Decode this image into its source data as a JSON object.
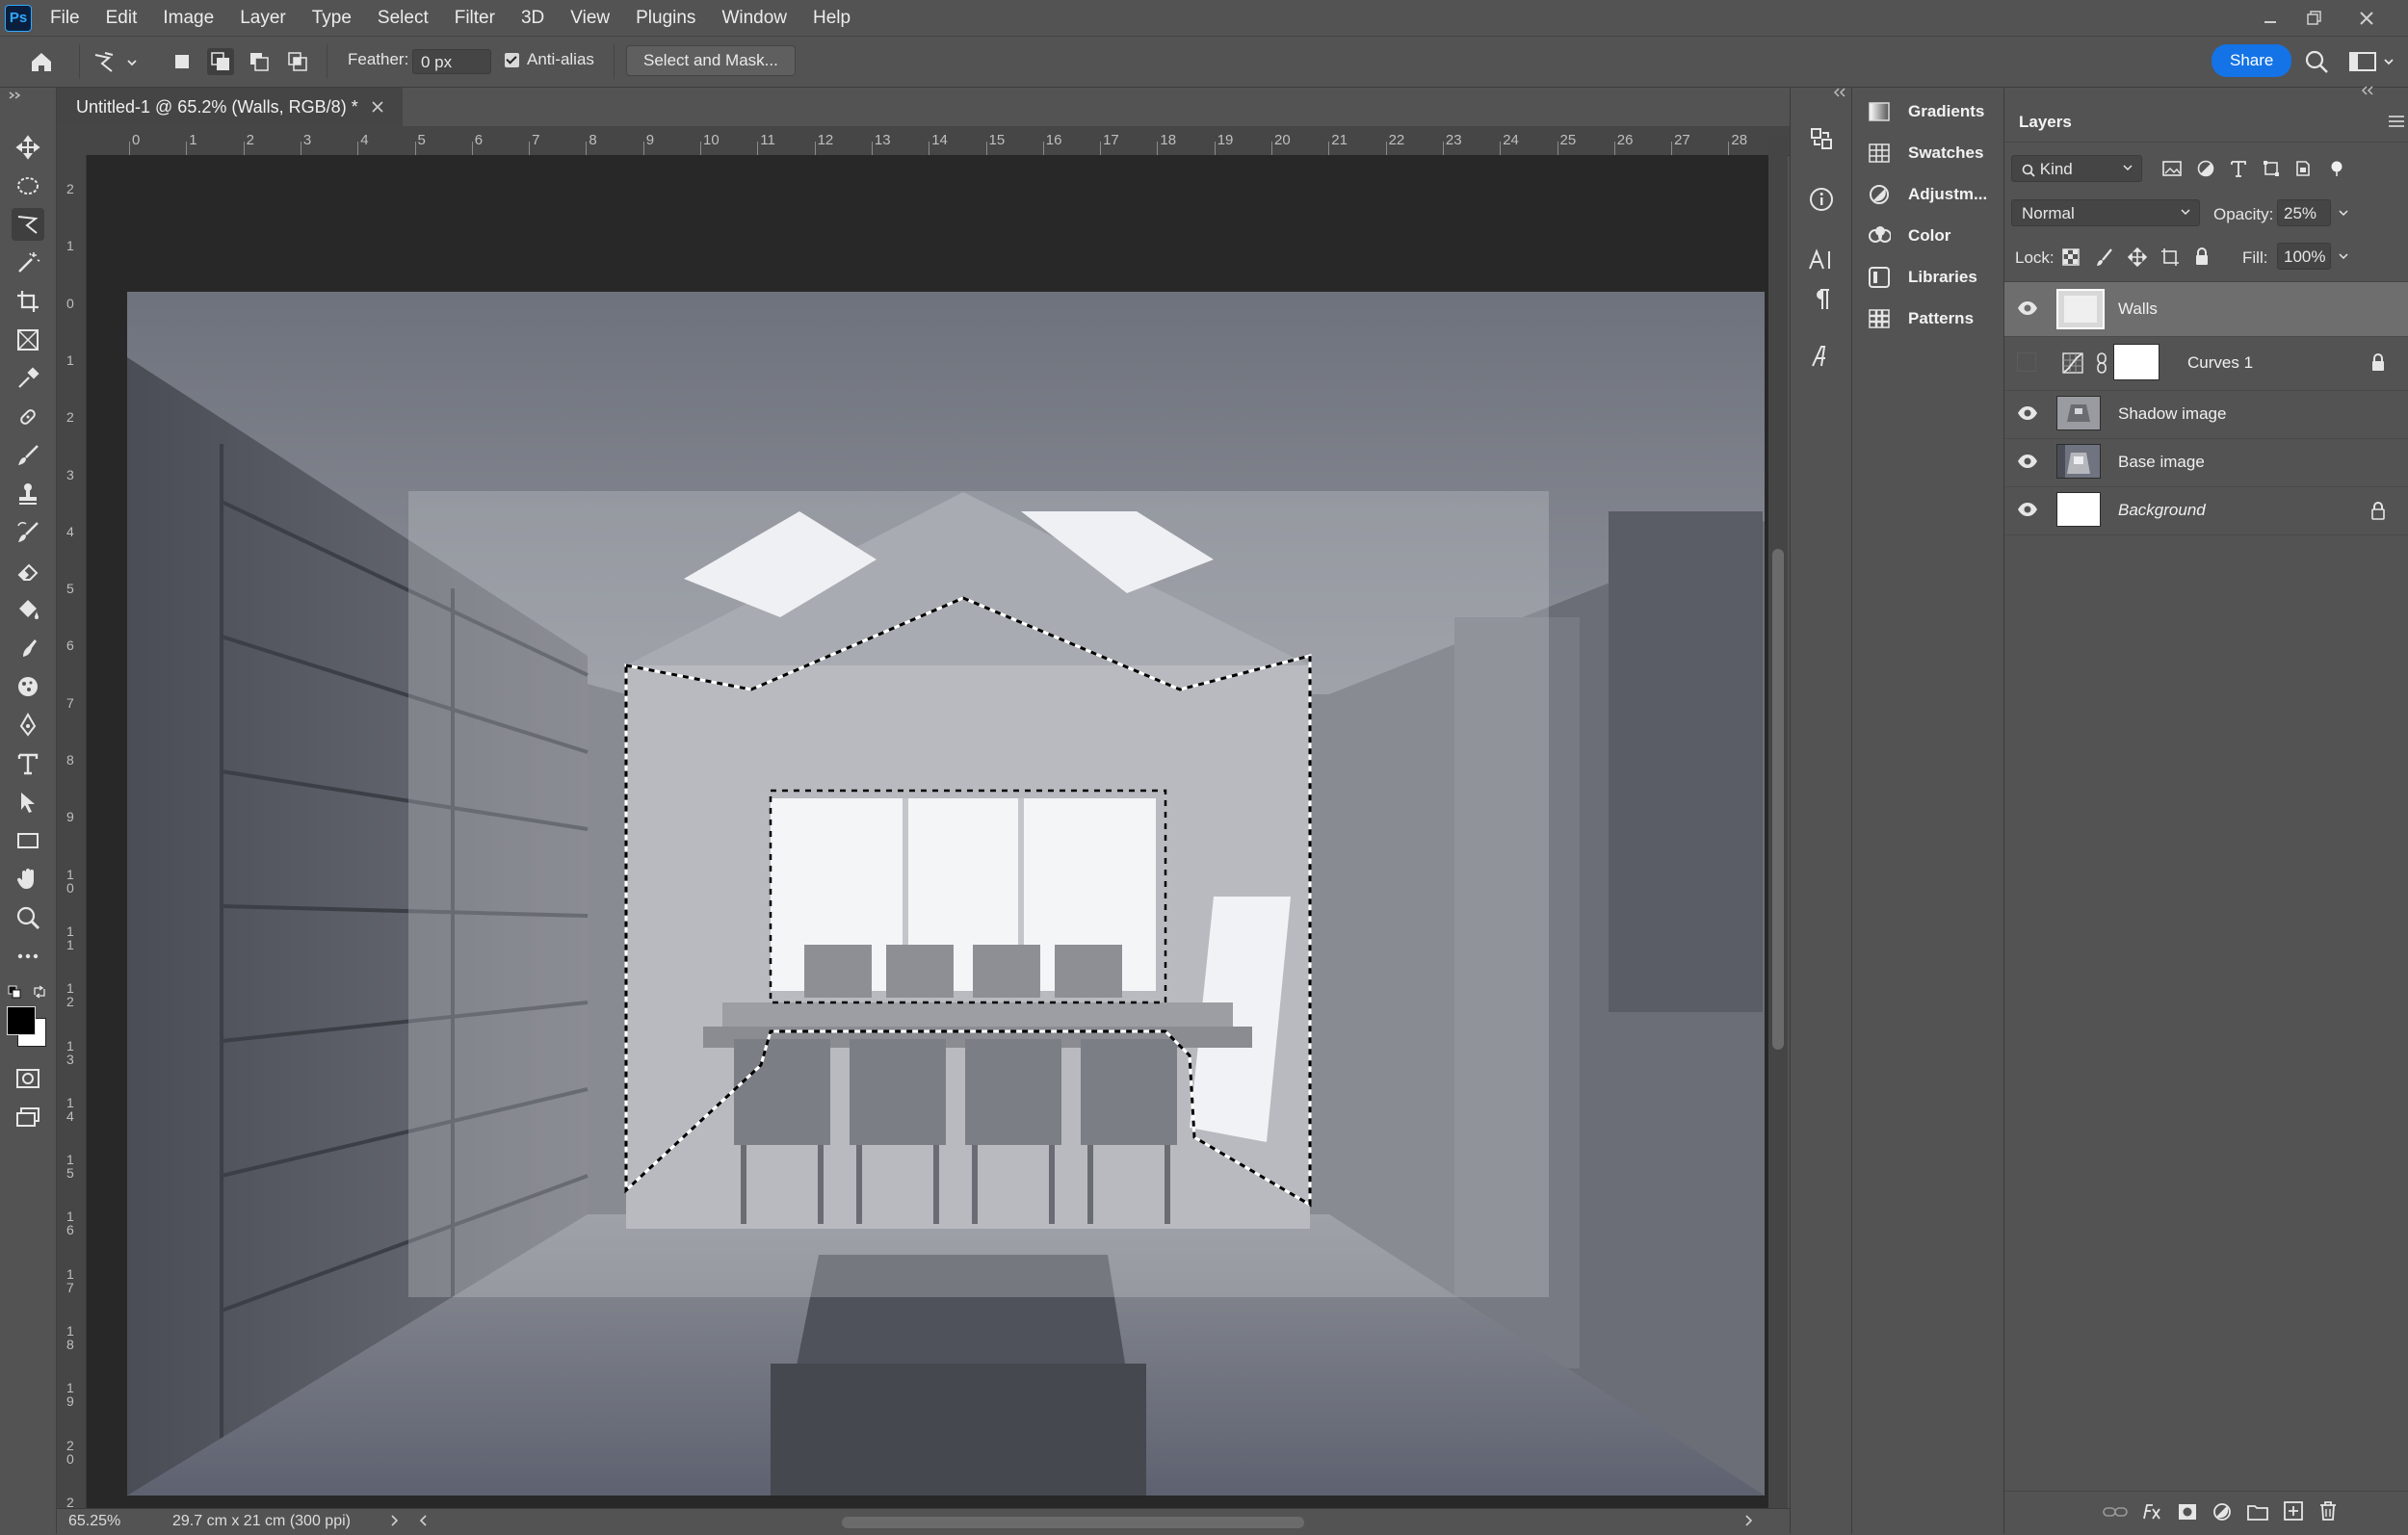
{
  "menu": {
    "app_icon": "Ps",
    "items": [
      "File",
      "Edit",
      "Image",
      "Layer",
      "Type",
      "Select",
      "Filter",
      "3D",
      "View",
      "Plugins",
      "Window",
      "Help"
    ]
  },
  "options": {
    "feather_label": "Feather:",
    "feather_value": "0 px",
    "antialias_label": "Anti-alias",
    "antialias_checked": true,
    "select_mask_label": "Select and Mask...",
    "share_label": "Share"
  },
  "document": {
    "tab_title": "Untitled-1 @ 65.2% (Walls, RGB/8) *",
    "zoom": "65.25%",
    "doc_size": "29.7 cm x 21 cm (300 ppi)",
    "ruler_top": [
      "0",
      "1",
      "2",
      "3",
      "4",
      "5",
      "6",
      "7",
      "8",
      "9",
      "10",
      "11",
      "12",
      "13",
      "14",
      "15",
      "16",
      "17",
      "18",
      "19",
      "20",
      "21",
      "22",
      "23",
      "24",
      "25",
      "26",
      "27",
      "28"
    ],
    "ruler_left": [
      "2",
      "1",
      "0",
      "1",
      "2",
      "3",
      "4",
      "5",
      "6",
      "7",
      "8",
      "9",
      "1 0",
      "1 1",
      "1 2",
      "1 3",
      "1 4",
      "1 5",
      "1 6",
      "1 7",
      "1 8",
      "1 9",
      "2 0",
      "2"
    ]
  },
  "panel_groups": [
    {
      "label": "Gradients",
      "icon": "gradients-icon"
    },
    {
      "label": "Swatches",
      "icon": "swatches-icon"
    },
    {
      "label": "Adjustm...",
      "icon": "adjustments-icon"
    },
    {
      "label": "Color",
      "icon": "color-icon"
    },
    {
      "label": "Libraries",
      "icon": "libraries-icon"
    },
    {
      "label": "Patterns",
      "icon": "patterns-icon"
    }
  ],
  "layers_panel": {
    "tab": "Layers",
    "filter_kind": "Kind",
    "blend_mode": "Normal",
    "opacity_label": "Opacity:",
    "opacity_value": "25%",
    "lock_label": "Lock:",
    "fill_label": "Fill:",
    "fill_value": "100%",
    "layers": [
      {
        "name": "Walls",
        "visible": true,
        "selected": true,
        "locked": false
      },
      {
        "name": "Curves 1",
        "visible": false,
        "selected": false,
        "locked": true,
        "adjustment": true
      },
      {
        "name": "Shadow image",
        "visible": true,
        "selected": false,
        "locked": false
      },
      {
        "name": "Base image",
        "visible": true,
        "selected": false,
        "locked": false
      },
      {
        "name": "Background",
        "visible": true,
        "selected": false,
        "locked": true,
        "italic": true
      }
    ]
  },
  "colors": {
    "accent": "#1473e6",
    "foreground": "#000000",
    "background": "#ffffff"
  }
}
